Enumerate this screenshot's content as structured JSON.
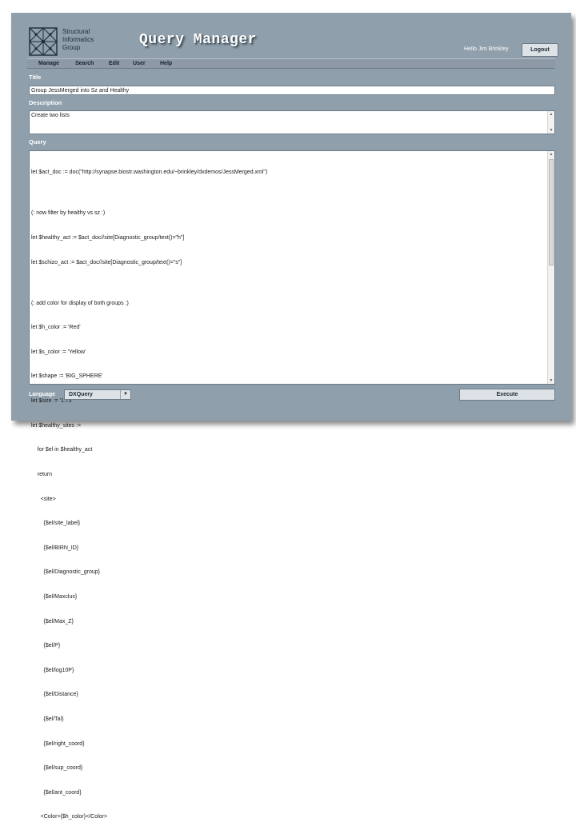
{
  "header": {
    "logo_lines": [
      "Structural",
      "Informatics",
      "Group"
    ],
    "app_title": "Query Manager",
    "greeting": "Hello Jim Brinkley",
    "logout_label": "Logout"
  },
  "menu": [
    "Manage",
    "Search",
    "Edit",
    "User",
    "Help"
  ],
  "title_section": {
    "label": "Title",
    "value": "Group JessMerged into Sz and Healthy"
  },
  "description_section": {
    "label": "Description",
    "value": "Create two lists"
  },
  "query_section": {
    "label": "Query",
    "lines": [
      "let $act_doc := doc(\"http://synapse.biostr.washington.edu/~brinkley/dxdemos/JessMerged.xml\")",
      "",
      "(: now filter by healthy vs sz :)",
      "let $healthy_act := $act_doc//site[Diagnostic_group/text()=\"h\"]",
      "let $schizo_act := $act_doc//site[Diagnostic_group/text()=\"s\"]",
      "",
      "(: add color for display of both groups :)",
      "let $h_color := 'Red'",
      "let $s_color := 'Yellow'",
      "let $shape := 'BIG_SPHERE'",
      "let $size := '1.75'",
      "let $healthy_sites :=",
      "    for $el in $healthy_act",
      "    return",
      "      <site>",
      "        {$el/site_label}",
      "        {$el/BIRN_ID}",
      "        {$el/Diagnostic_group}",
      "        {$el/Maxclus}",
      "        {$el/Max_Z}",
      "        {$el/P}",
      "        {$el/log10P}",
      "        {$el/Distance}",
      "        {$el/Tal}",
      "        {$el/right_coord}",
      "        {$el/sup_coord}",
      "        {$el/ant_coord}",
      "      <Color>{$h_color}</Color>"
    ]
  },
  "footer": {
    "language_label": "Language",
    "language_value": "DXQuery",
    "execute_label": "Execute"
  }
}
